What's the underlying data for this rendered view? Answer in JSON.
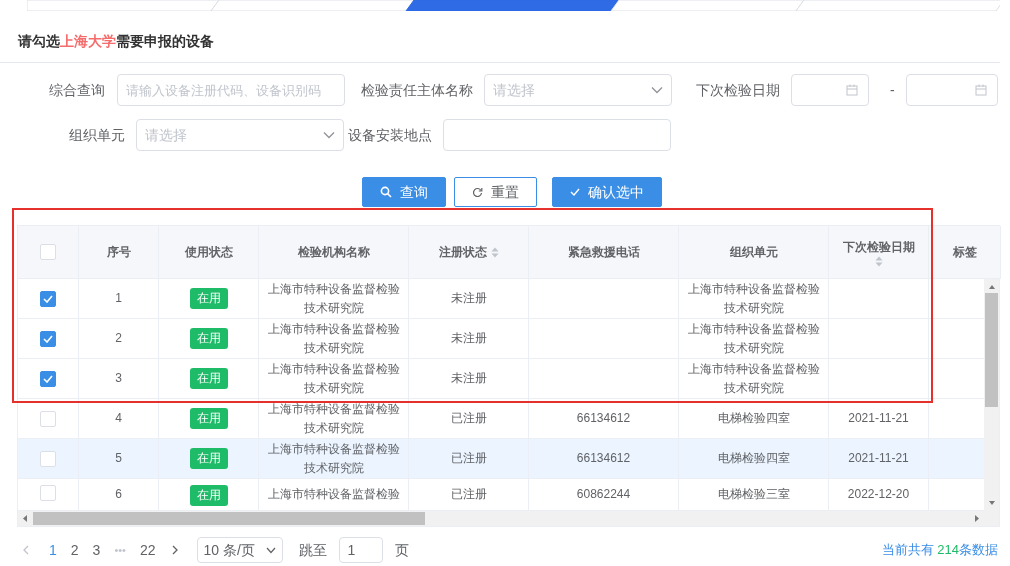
{
  "steps": [
    {
      "selected": false
    },
    {
      "selected": false
    },
    {
      "selected": true
    },
    {
      "selected": false
    },
    {
      "selected": false
    }
  ],
  "title": {
    "before": "请勾选",
    "highlight": "上海大学",
    "after": "需要申报的设备"
  },
  "filters": [
    [
      {
        "kind": "text",
        "label": "综合查询",
        "placeholder": "请输入设备注册代码、设备识别码"
      },
      {
        "kind": "select",
        "label": "检验责任主体名称",
        "placeholder": "请选择"
      },
      {
        "kind": "daterange",
        "label": "下次检验日期",
        "separator": "-"
      }
    ],
    [
      {
        "kind": "select",
        "label": "组织单元",
        "placeholder": "请选择"
      },
      {
        "kind": "text",
        "label": "设备安装地点"
      }
    ]
  ],
  "buttons": [
    {
      "kind": "search",
      "label": "查询"
    },
    {
      "kind": "reset",
      "label": "重置"
    },
    {
      "kind": "confirm",
      "label": "确认选中"
    }
  ],
  "table": {
    "select_all": {
      "checked": false
    },
    "columns": [
      {
        "label": "序号",
        "sortable": false
      },
      {
        "label": "使用状态",
        "sortable": false
      },
      {
        "label": "检验机构名称",
        "sortable": false
      },
      {
        "label": "注册状态",
        "sortable": true
      },
      {
        "label": "紧急救援电话",
        "sortable": false
      },
      {
        "label": "组织单元",
        "sortable": false
      },
      {
        "label": "下次检验日期",
        "sortable": true
      },
      {
        "label": "标签",
        "sortable": false
      }
    ],
    "rows": [
      {
        "checked": true,
        "highlighted": false,
        "cells": [
          "1",
          "在用",
          "上海市特种设备监督检验技术研究院",
          "未注册",
          "",
          "上海市特种设备监督检验技术研究院",
          ""
        ]
      },
      {
        "checked": true,
        "highlighted": false,
        "cells": [
          "2",
          "在用",
          "上海市特种设备监督检验技术研究院",
          "未注册",
          "",
          "上海市特种设备监督检验技术研究院",
          ""
        ]
      },
      {
        "checked": true,
        "highlighted": false,
        "cells": [
          "3",
          "在用",
          "上海市特种设备监督检验技术研究院",
          "未注册",
          "",
          "上海市特种设备监督检验技术研究院",
          ""
        ]
      },
      {
        "checked": false,
        "highlighted": false,
        "cells": [
          "4",
          "在用",
          "上海市特种设备监督检验技术研究院",
          "已注册",
          "66134612",
          "电梯检验四室",
          "2021-11-21"
        ]
      },
      {
        "checked": false,
        "highlighted": true,
        "cells": [
          "5",
          "在用",
          "上海市特种设备监督检验技术研究院",
          "已注册",
          "66134612",
          "电梯检验四室",
          "2021-11-21"
        ]
      },
      {
        "checked": false,
        "highlighted": false,
        "cells": [
          "6",
          "在用",
          "上海市特种设备监督检验",
          "已注册",
          "60862244",
          "电梯检验三室",
          "2022-12-20"
        ]
      }
    ]
  },
  "pagination": {
    "pages": [
      {
        "label": "1",
        "selected": true
      },
      {
        "label": "2",
        "selected": false
      },
      {
        "label": "3",
        "selected": false
      },
      {
        "label": "•••",
        "selected": false
      },
      {
        "label": "22",
        "selected": false
      }
    ],
    "page_size": "10 条/页",
    "jump_label": "跳至",
    "jump_value": "1",
    "jump_unit": "页",
    "total": {
      "before": "当前共有 ",
      "count": "214",
      "after": "条数据"
    }
  }
}
